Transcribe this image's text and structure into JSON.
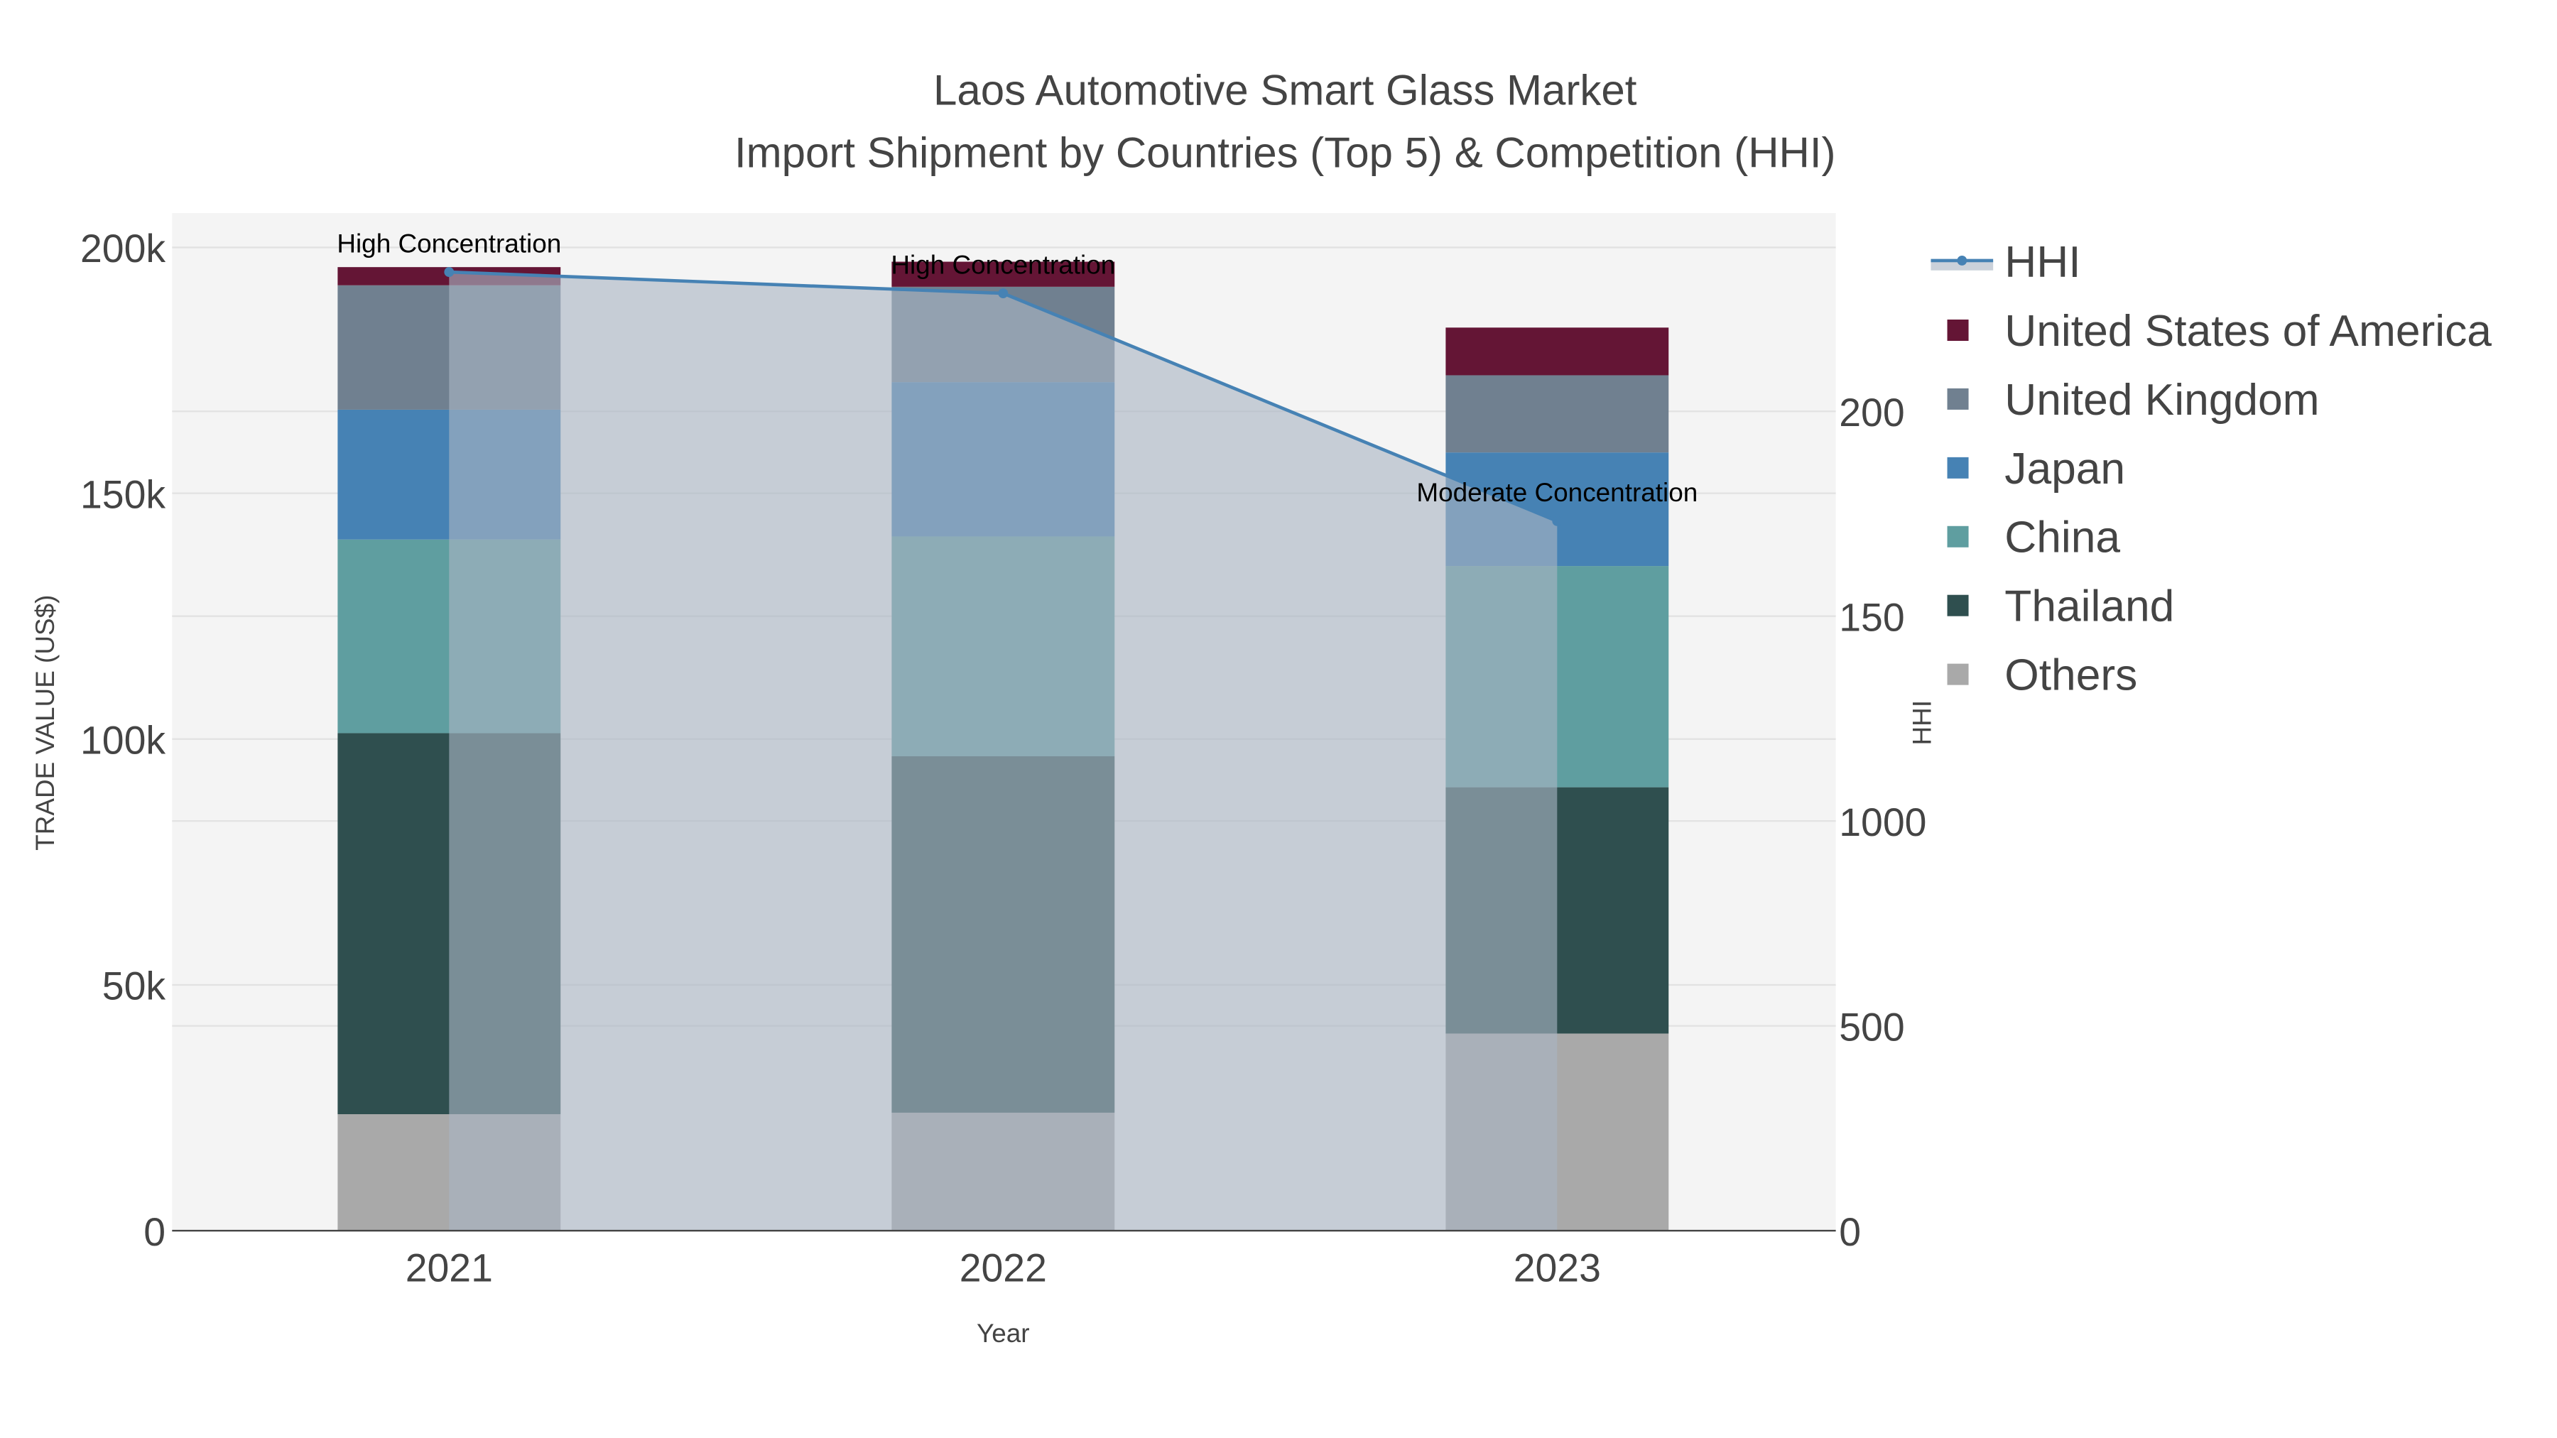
{
  "chart_data": {
    "type": "bar",
    "barmode": "stack",
    "title": "Laos Automotive Smart Glass Market",
    "subtitle": "Import Shipment by Countries (Top 5) & Competition (HHI)",
    "xlabel": "Year",
    "ylabel": "TRADE VALUE (US$)",
    "y2label": "HHI",
    "categories": [
      "2021",
      "2022",
      "2023"
    ],
    "ylim": [
      0,
      207000
    ],
    "y_ticks": [
      0,
      50000,
      100000,
      150000,
      200000
    ],
    "y_tick_labels": [
      "0",
      "50k",
      "100k",
      "150k",
      "200k"
    ],
    "y2lim": [
      0,
      2484
    ],
    "y2_ticks": [
      0,
      500,
      1000,
      1500,
      2000
    ],
    "y2_tick_labels": [
      "0",
      "500",
      "1000",
      "150",
      "200"
    ],
    "grid": true,
    "legend_position": "right",
    "series": [
      {
        "name": "Others",
        "color": "#A9A9A9",
        "values": [
          23700,
          24000,
          40100
        ]
      },
      {
        "name": "Thailand",
        "color": "#2F4F4F",
        "values": [
          77500,
          72500,
          50100
        ]
      },
      {
        "name": "China",
        "color": "#5F9EA0",
        "values": [
          39400,
          44700,
          45000
        ]
      },
      {
        "name": "Japan",
        "color": "#4682B4",
        "values": [
          26400,
          31400,
          23100
        ]
      },
      {
        "name": "United Kingdom",
        "color": "#708090",
        "values": [
          25300,
          19400,
          15700
        ]
      },
      {
        "name": "United States of America",
        "color": "#641535",
        "values": [
          3700,
          5100,
          9700
        ]
      }
    ],
    "line": {
      "name": "HHI",
      "color": "#4682B4",
      "axis": "y2",
      "values": [
        2340,
        2288,
        1732
      ],
      "fill": "tozeroy"
    },
    "annotations": [
      "High Concentration",
      "High Concentration",
      "Moderate Concentration"
    ],
    "legend_order": [
      "HHI",
      "United States of America",
      "United Kingdom",
      "Japan",
      "China",
      "Thailand",
      "Others"
    ]
  }
}
